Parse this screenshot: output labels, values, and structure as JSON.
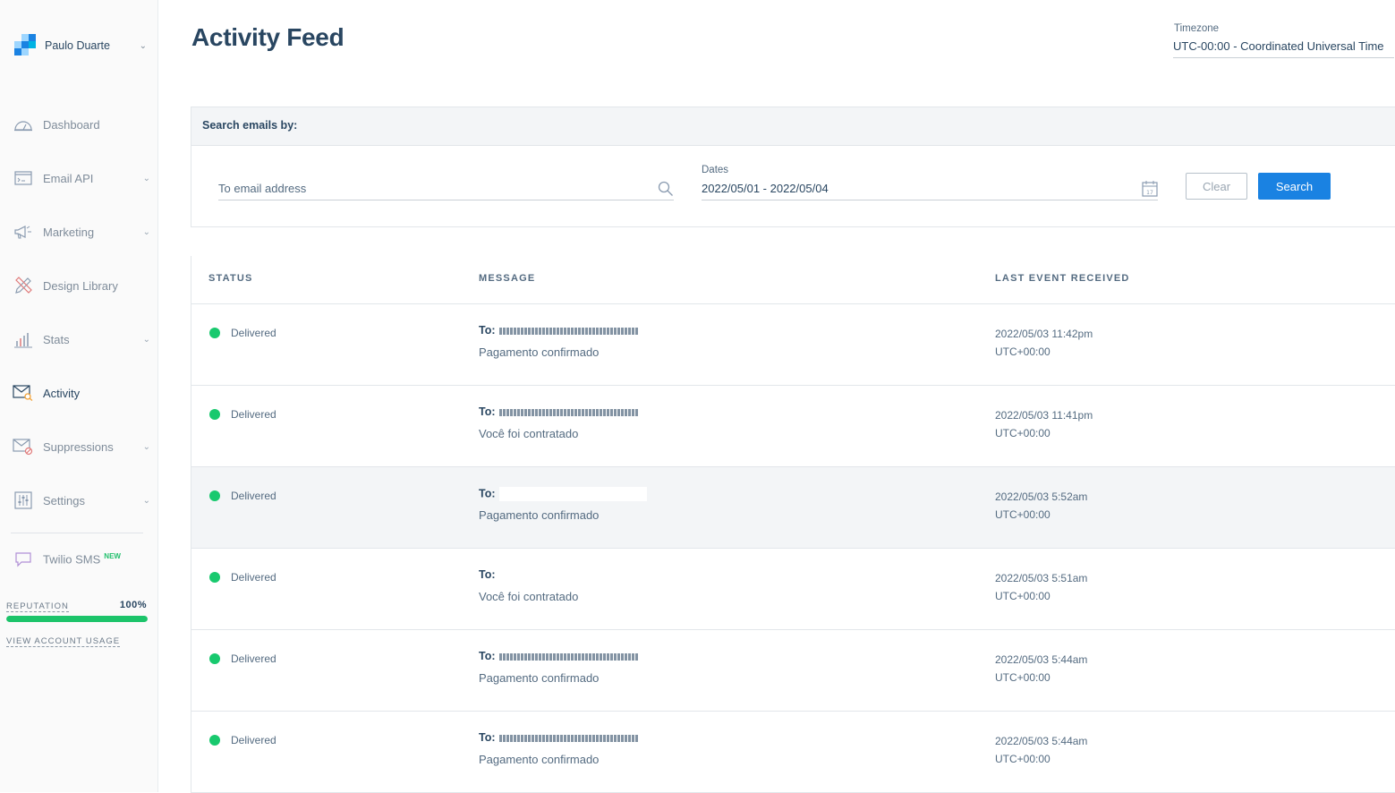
{
  "account": {
    "name": "Paulo Duarte"
  },
  "sidebar": {
    "items": [
      {
        "label": "Dashboard",
        "icon": "gauge-icon",
        "has_submenu": false
      },
      {
        "label": "Email API",
        "icon": "code-window-icon",
        "has_submenu": true
      },
      {
        "label": "Marketing",
        "icon": "megaphone-icon",
        "has_submenu": true
      },
      {
        "label": "Design Library",
        "icon": "pencil-ruler-icon",
        "has_submenu": false
      },
      {
        "label": "Stats",
        "icon": "bar-chart-icon",
        "has_submenu": true
      },
      {
        "label": "Activity",
        "icon": "envelope-search-icon",
        "has_submenu": false,
        "active": true
      },
      {
        "label": "Suppressions",
        "icon": "envelope-block-icon",
        "has_submenu": true
      },
      {
        "label": "Settings",
        "icon": "sliders-icon",
        "has_submenu": true
      }
    ],
    "twilio": {
      "label": "Twilio SMS",
      "badge": "NEW",
      "icon": "chat-bubble-icon"
    },
    "reputation": {
      "label": "REPUTATION",
      "value": "100%",
      "fraction": 1.0
    },
    "usage_link": "VIEW ACCOUNT USAGE"
  },
  "page": {
    "title": "Activity Feed"
  },
  "timezone": {
    "label": "Timezone",
    "value": "UTC-00:00 - Coordinated Universal Time"
  },
  "search": {
    "header": "Search emails by:",
    "to_placeholder": "To email address",
    "dates_label": "Dates",
    "dates_value": "2022/05/01 - 2022/05/04",
    "clear_label": "Clear",
    "search_label": "Search"
  },
  "table": {
    "columns": [
      "STATUS",
      "MESSAGE",
      "LAST EVENT RECEIVED"
    ],
    "rows": [
      {
        "status": "Delivered",
        "to_prefix": "To:",
        "subject": "Pagamento confirmado",
        "date": "2022/05/03 11:42pm",
        "tz": "UTC+00:00"
      },
      {
        "status": "Delivered",
        "to_prefix": "To:",
        "subject": "Você foi contratado",
        "date": "2022/05/03 11:41pm",
        "tz": "UTC+00:00"
      },
      {
        "status": "Delivered",
        "to_prefix": "To:",
        "subject": "Pagamento confirmado",
        "date": "2022/05/03 5:52am",
        "tz": "UTC+00:00"
      },
      {
        "status": "Delivered",
        "to_prefix": "To:",
        "subject": "Você foi contratado",
        "date": "2022/05/03 5:51am",
        "tz": "UTC+00:00"
      },
      {
        "status": "Delivered",
        "to_prefix": "To:",
        "subject": "Pagamento confirmado",
        "date": "2022/05/03 5:44am",
        "tz": "UTC+00:00"
      },
      {
        "status": "Delivered",
        "to_prefix": "To:",
        "subject": "Pagamento confirmado",
        "date": "2022/05/03 5:44am",
        "tz": "UTC+00:00"
      }
    ]
  },
  "colors": {
    "accent": "#1a82e2",
    "delivered": "#18c96e",
    "text": "#294661",
    "reputation": "#1cc46a"
  }
}
